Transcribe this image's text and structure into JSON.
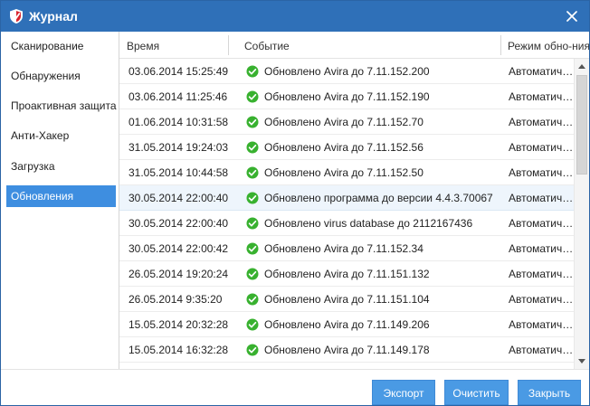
{
  "window": {
    "title": "Журнал",
    "accent": "#2f70b8"
  },
  "sidebar": {
    "items": [
      {
        "label": "Сканирование",
        "active": false
      },
      {
        "label": "Обнаружения",
        "active": false
      },
      {
        "label": "Проактивная защита",
        "active": false
      },
      {
        "label": "Анти-Хакер",
        "active": false
      },
      {
        "label": "Загрузка",
        "active": false
      },
      {
        "label": "Обновления",
        "active": true
      }
    ]
  },
  "table": {
    "columns": [
      "Время",
      "Событие",
      "Режим обно-ния"
    ],
    "rows": [
      {
        "time": "03.06.2014 15:25:49",
        "event": "Обновлено Avira до 7.11.152.200",
        "mode": "Автоматич…",
        "status_icon": "check-circle-icon",
        "selected": false
      },
      {
        "time": "03.06.2014 11:25:46",
        "event": "Обновлено Avira до 7.11.152.190",
        "mode": "Автоматич…",
        "status_icon": "check-circle-icon",
        "selected": false
      },
      {
        "time": "01.06.2014 10:31:58",
        "event": "Обновлено Avira до 7.11.152.70",
        "mode": "Автоматич…",
        "status_icon": "check-circle-icon",
        "selected": false
      },
      {
        "time": "31.05.2014 19:24:03",
        "event": "Обновлено Avira до 7.11.152.56",
        "mode": "Автоматич…",
        "status_icon": "check-circle-icon",
        "selected": false
      },
      {
        "time": "31.05.2014 10:44:58",
        "event": "Обновлено Avira до 7.11.152.50",
        "mode": "Автоматич…",
        "status_icon": "check-circle-icon",
        "selected": false
      },
      {
        "time": "30.05.2014 22:00:40",
        "event": "Обновлено программа до версии 4.4.3.70067",
        "mode": "Автоматич…",
        "status_icon": "check-circle-icon",
        "selected": true
      },
      {
        "time": "30.05.2014 22:00:40",
        "event": "Обновлено virus database до 2112167436",
        "mode": "Автоматич…",
        "status_icon": "check-circle-icon",
        "selected": false
      },
      {
        "time": "30.05.2014 22:00:42",
        "event": "Обновлено Avira до 7.11.152.34",
        "mode": "Автоматич…",
        "status_icon": "check-circle-icon",
        "selected": false
      },
      {
        "time": "26.05.2014 19:20:24",
        "event": "Обновлено Avira до 7.11.151.132",
        "mode": "Автоматич…",
        "status_icon": "check-circle-icon",
        "selected": false
      },
      {
        "time": "26.05.2014 9:35:20",
        "event": "Обновлено Avira до 7.11.151.104",
        "mode": "Автоматич…",
        "status_icon": "check-circle-icon",
        "selected": false
      },
      {
        "time": "15.05.2014 20:32:28",
        "event": "Обновлено Avira до 7.11.149.206",
        "mode": "Автоматич…",
        "status_icon": "check-circle-icon",
        "selected": false
      },
      {
        "time": "15.05.2014 16:32:28",
        "event": "Обновлено Avira до 7.11.149.178",
        "mode": "Автоматич…",
        "status_icon": "check-circle-icon",
        "selected": false
      },
      {
        "time": "",
        "event": "",
        "mode": "",
        "status_icon": "",
        "selected": false
      }
    ]
  },
  "buttons": {
    "export_label": "Экспорт",
    "clear_label": "Очистить",
    "close_label": "Закрыть"
  },
  "icons": {
    "app": "shield-icon",
    "close": "close-icon",
    "success": "check-circle-icon",
    "scroll_up": "arrow-up-icon",
    "scroll_down": "arrow-down-icon"
  },
  "colors": {
    "titlebar": "#2f70b8",
    "selected_nav": "#3e8ee0",
    "button": "#4a9ae4",
    "success": "#38b12f",
    "selected_row": "#eef5fc"
  }
}
